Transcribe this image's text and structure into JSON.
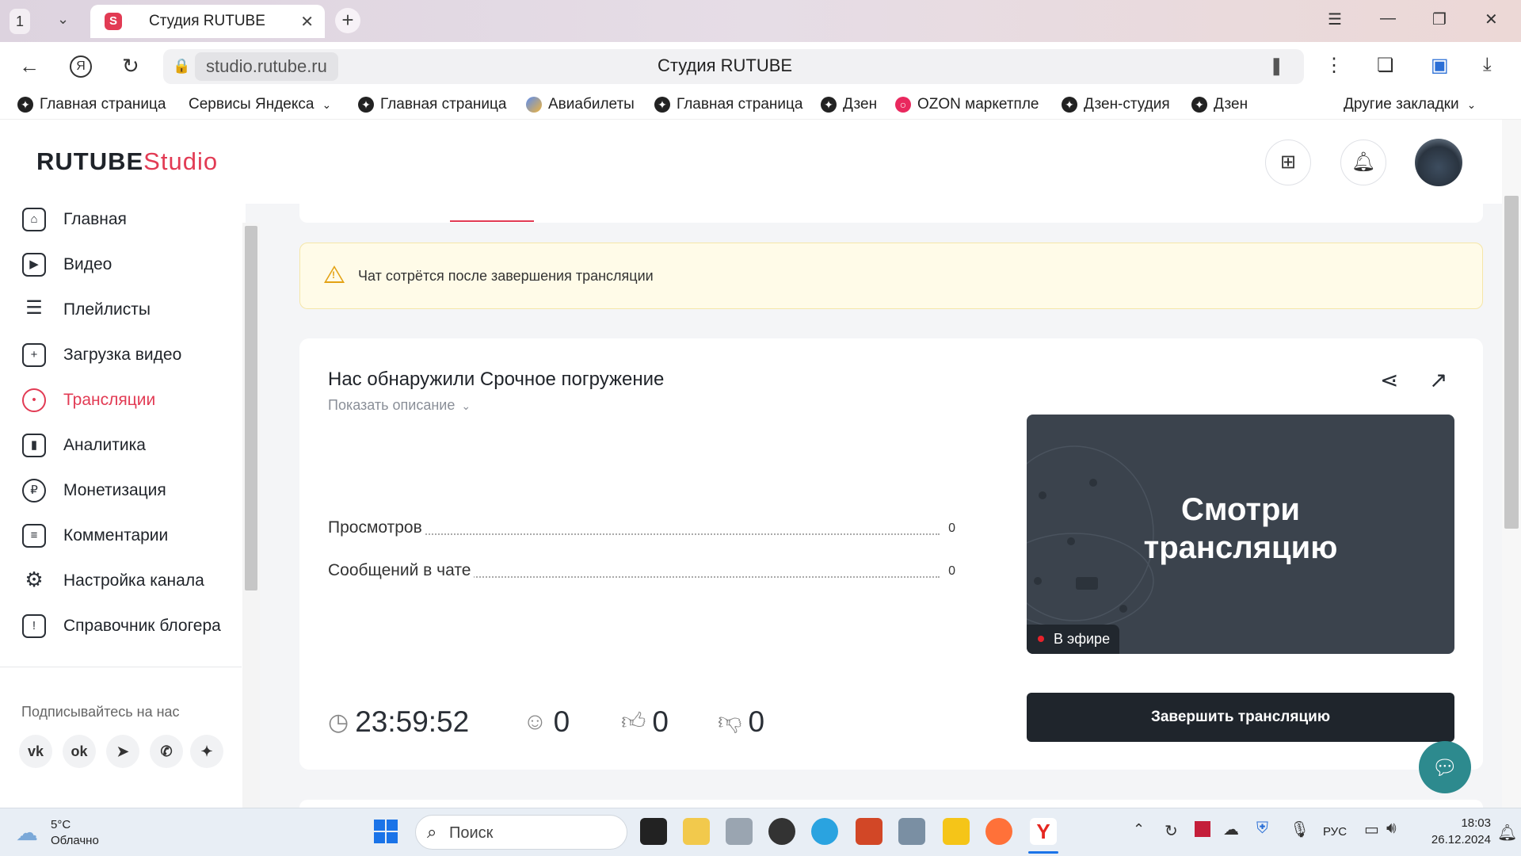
{
  "browser": {
    "tab_count": "1",
    "tab_title": "Студия RUTUBE",
    "tab_favicon": "S",
    "url": "studio.rutube.ru",
    "page_title": "Студия RUTUBE",
    "bookmarks": [
      {
        "label": "Главная страница",
        "icon": "dzen-icon"
      },
      {
        "label": "Сервисы Яндекса",
        "icon": "none"
      },
      {
        "label": "Главная страница",
        "icon": "dzen-icon"
      },
      {
        "label": "Авиабилеты",
        "icon": "globe-icon"
      },
      {
        "label": "Главная страница",
        "icon": "dzen-icon"
      },
      {
        "label": "Дзен",
        "icon": "dzen-icon"
      },
      {
        "label": "OZON маркетпле",
        "icon": "ozon-icon"
      },
      {
        "label": "Дзен-студия",
        "icon": "dzen-icon"
      },
      {
        "label": "Дзен",
        "icon": "dzen-icon"
      }
    ],
    "other_bookmarks": "Другие закладки"
  },
  "app": {
    "logo_main": "RUTUBE",
    "logo_studio": "Studio",
    "accent_color": "#e23b54"
  },
  "sidebar": {
    "items": [
      {
        "label": "Главная",
        "icon": "home-icon",
        "active": false
      },
      {
        "label": "Видео",
        "icon": "play-icon",
        "active": false
      },
      {
        "label": "Плейлисты",
        "icon": "list-icon",
        "active": false
      },
      {
        "label": "Загрузка видео",
        "icon": "upload-icon",
        "active": false
      },
      {
        "label": "Трансляции",
        "icon": "broadcast-icon",
        "active": true
      },
      {
        "label": "Аналитика",
        "icon": "chart-icon",
        "active": false
      },
      {
        "label": "Монетизация",
        "icon": "ruble-icon",
        "active": false
      },
      {
        "label": "Комментарии",
        "icon": "comment-icon",
        "active": false
      },
      {
        "label": "Настройка канала",
        "icon": "gear-icon",
        "active": false
      },
      {
        "label": "Справочник блогера",
        "icon": "info-icon",
        "active": false
      }
    ],
    "subscribe_title": "Подписывайтесь на нас",
    "socials": [
      "vk-icon",
      "ok-icon",
      "telegram-icon",
      "viber-icon",
      "dzen-icon"
    ]
  },
  "main": {
    "warning_text": "Чат сотрётся после завершения трансляции",
    "stream_title": "Нас обнаружили Срочное погружение",
    "show_description": "Показать описание",
    "stats": [
      {
        "label": "Просмотров",
        "value": "0"
      },
      {
        "label": "Сообщений в чате",
        "value": "0"
      }
    ],
    "preview_text_line1": "Смотри",
    "preview_text_line2": "трансляцию",
    "live_badge": "В эфире",
    "end_button": "Завершить трансляцию",
    "counters": {
      "duration": "23:59:52",
      "viewers": "0",
      "likes": "0",
      "dislikes": "0"
    }
  },
  "taskbar": {
    "weather_temp": "5°C",
    "weather_desc": "Облачно",
    "search_placeholder": "Поиск",
    "language": "РУС",
    "time": "18:03",
    "date": "26.12.2024"
  }
}
